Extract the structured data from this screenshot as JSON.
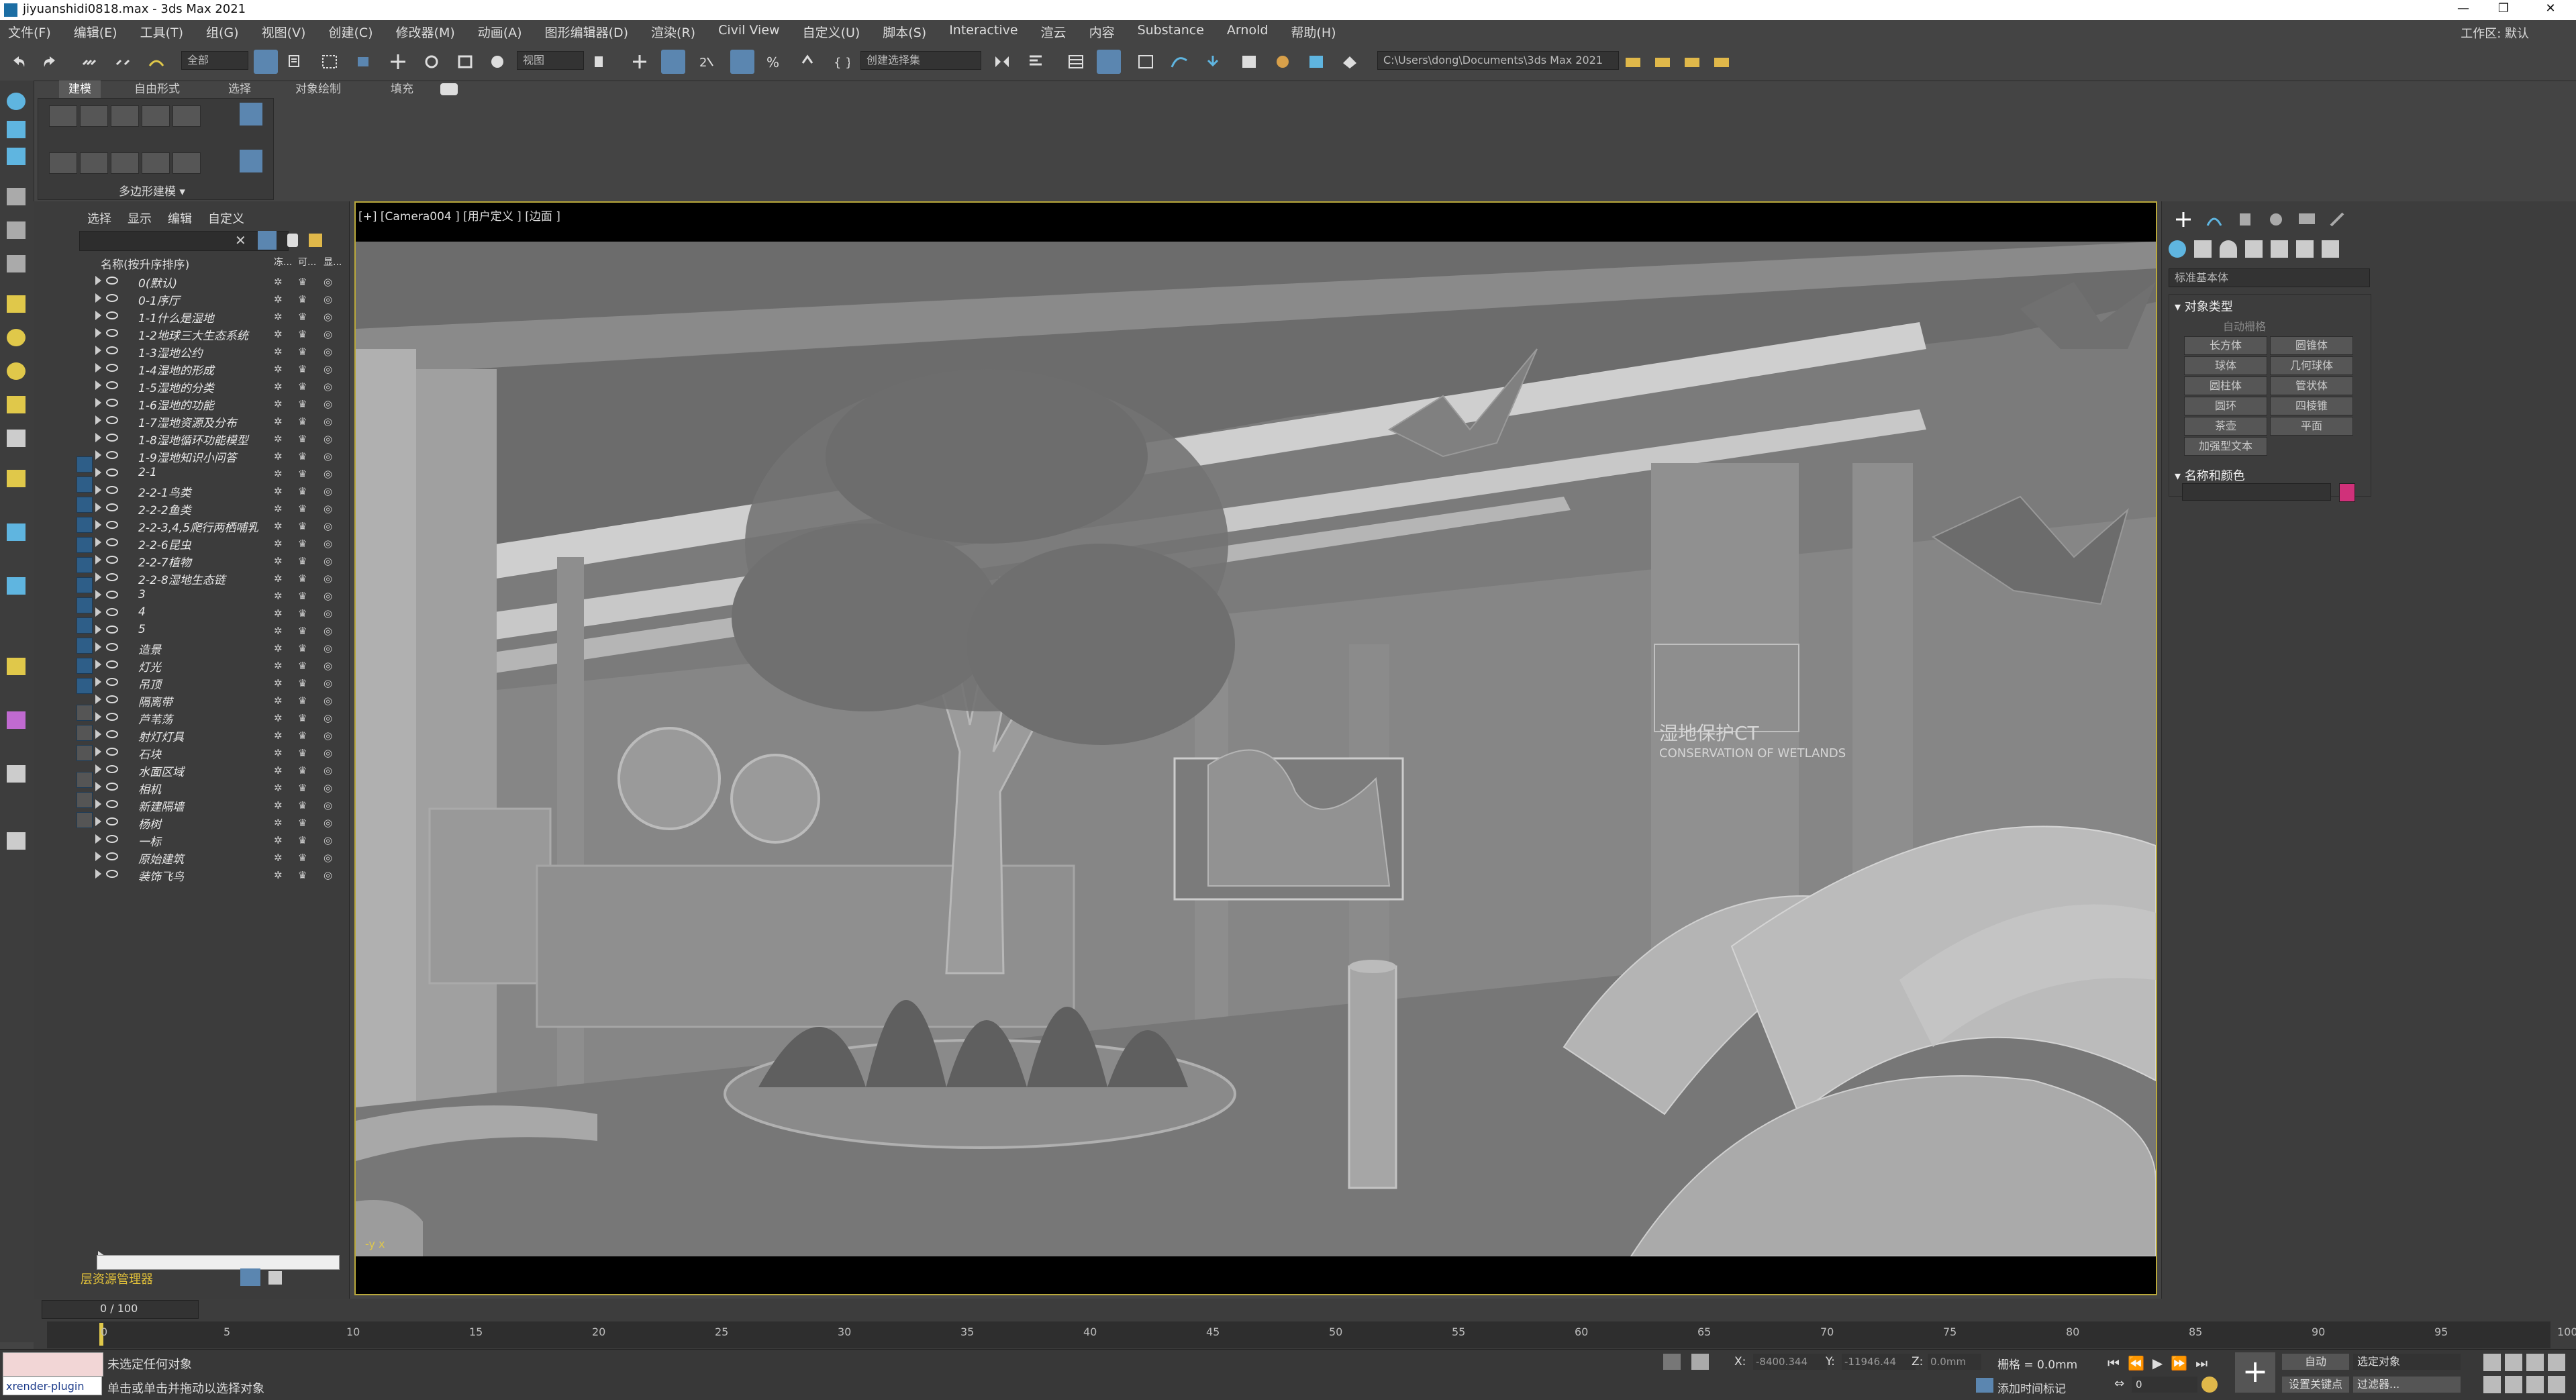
{
  "title": "jiyuanshidi0818.max - 3ds Max 2021",
  "menu": [
    "文件(F)",
    "编辑(E)",
    "工具(T)",
    "组(G)",
    "视图(V)",
    "创建(C)",
    "修改器(M)",
    "动画(A)",
    "图形编辑器(D)",
    "渲染(R)",
    "Civil View",
    "自定义(U)",
    "脚本(S)",
    "Interactive",
    "渲云",
    "内容",
    "Substance",
    "Arnold",
    "帮助(H)"
  ],
  "workspace": "工作区: 默认",
  "toolbar": {
    "filter": "全部",
    "view": "视图",
    "selection_set": "创建选择集",
    "path": "C:\\Users\\dong\\Documents\\3ds Max 2021"
  },
  "ribbon": {
    "tabs": [
      "建模",
      "自由形式",
      "选择",
      "对象绘制",
      "填充"
    ],
    "label": "多边形建模"
  },
  "scene_explorer": {
    "menu": [
      "选择",
      "显示",
      "编辑",
      "自定义"
    ],
    "header": "名称(按升序排序)",
    "col_headers": [
      "冻...",
      "可...",
      "显..."
    ],
    "layers": [
      "0(默认)",
      "0-1序厅",
      "1-1什么是湿地",
      "1-2地球三大生态系统",
      "1-3湿地公约",
      "1-4湿地的形成",
      "1-5湿地的分类",
      "1-6湿地的功能",
      "1-7湿地资源及分布",
      "1-8湿地循环功能模型",
      "1-9湿地知识小问答",
      "2-1",
      "2-2-1鸟类",
      "2-2-2鱼类",
      "2-2-3,4,5爬行两栖哺乳",
      "2-2-6昆虫",
      "2-2-7植物",
      "2-2-8湿地生态链",
      "3",
      "4",
      "5",
      "造景",
      "灯光",
      "吊顶",
      "隔离带",
      "芦苇荡",
      "射灯灯具",
      "石块",
      "水面区域",
      "相机",
      "新建隔墙",
      "杨树",
      "一标",
      "原始建筑",
      "装饰飞鸟"
    ],
    "footer_label": "层资源管理器"
  },
  "viewport": {
    "label": "[+] [Camera004 ] [用户定义 ] [边面 ]",
    "scene_text_1": "湿地保护CT",
    "scene_text_2": "CONSERVATION OF WETLANDS",
    "axis": "-y x"
  },
  "command_panel": {
    "dropdown": "标准基本体",
    "rollout1": "对象类型",
    "autogrid": "自动栅格",
    "buttons": [
      "长方体",
      "圆锥体",
      "球体",
      "几何球体",
      "圆柱体",
      "管状体",
      "圆环",
      "四棱锥",
      "茶壶",
      "平面",
      "加强型文本"
    ],
    "rollout2": "名称和颜色",
    "color": "#d0317a"
  },
  "timeline": {
    "frame_display": "0 / 100",
    "ticks": [
      "0",
      "5",
      "10",
      "15",
      "20",
      "25",
      "30",
      "35",
      "40",
      "45",
      "50",
      "55",
      "60",
      "65",
      "70",
      "75",
      "80",
      "85",
      "90",
      "95",
      "100"
    ]
  },
  "status": {
    "plugin": "xrender-plugin",
    "line1": "未选定任何对象",
    "line2": "单击或单击并拖动以选择对象",
    "x": "-8400.344",
    "y": "-11946.44",
    "z": "0.0mm",
    "grid": "栅格 = 0.0mm",
    "add_time_tag": "添加时间标记",
    "auto": "自动",
    "set_key": "设置关键点",
    "selected": "选定对象",
    "filter": "过滤器...",
    "frame": "0"
  }
}
